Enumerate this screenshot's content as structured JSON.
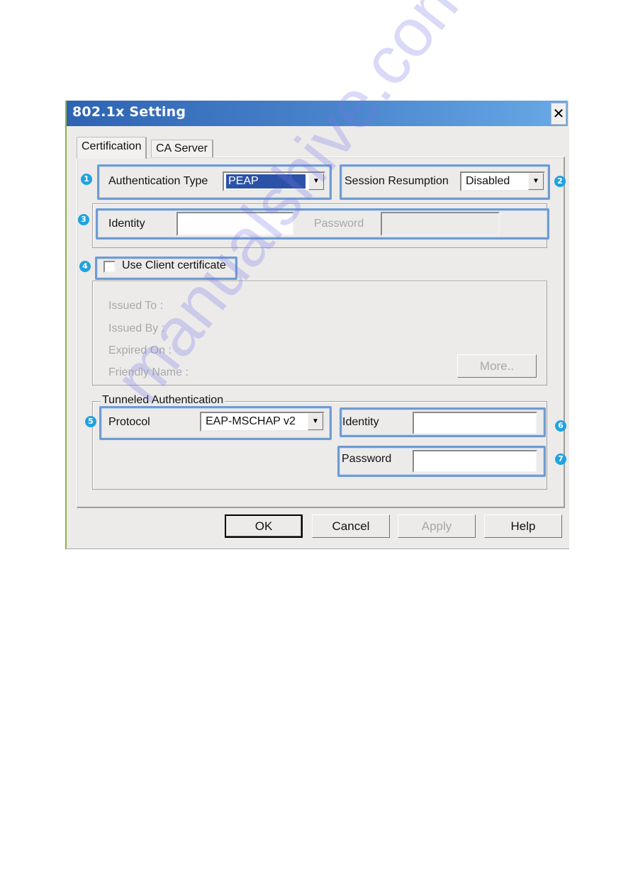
{
  "window": {
    "title": "802.1x Setting",
    "close_label": "✕"
  },
  "tabs": [
    {
      "label": "Certification",
      "active": true
    },
    {
      "label": "CA Server",
      "active": false
    }
  ],
  "badges": [
    "1",
    "2",
    "3",
    "4",
    "5",
    "6",
    "7"
  ],
  "auth_type": {
    "label": "Authentication Type",
    "value": "PEAP"
  },
  "session_resumption": {
    "label": "Session Resumption",
    "value": "Disabled"
  },
  "identity": {
    "label": "Identity",
    "value": ""
  },
  "password": {
    "label": "Password",
    "value": ""
  },
  "client_cert": {
    "label": "Use Client certificate",
    "checked": false,
    "fields": [
      "Issued To :",
      "Issued By :",
      "Expired On :",
      "Friendly Name :"
    ],
    "more_label": "More.."
  },
  "tunneled": {
    "legend": "Tunneled Authentication",
    "protocol_label": "Protocol",
    "protocol_value": "EAP-MSCHAP v2",
    "identity_label": "Identity",
    "identity_value": "",
    "password_label": "Password",
    "password_value": ""
  },
  "buttons": {
    "ok": "OK",
    "cancel": "Cancel",
    "apply": "Apply",
    "help": "Help"
  },
  "icons": {
    "dropdown": "▼"
  },
  "watermark": "manualshive.com",
  "colors": {
    "titlebar_start": "#2e63b3",
    "titlebar_end": "#68a9e6",
    "highlight_border": "#6f9bd3",
    "badge": "#1fa3e0",
    "selection": "#2b52a7"
  }
}
